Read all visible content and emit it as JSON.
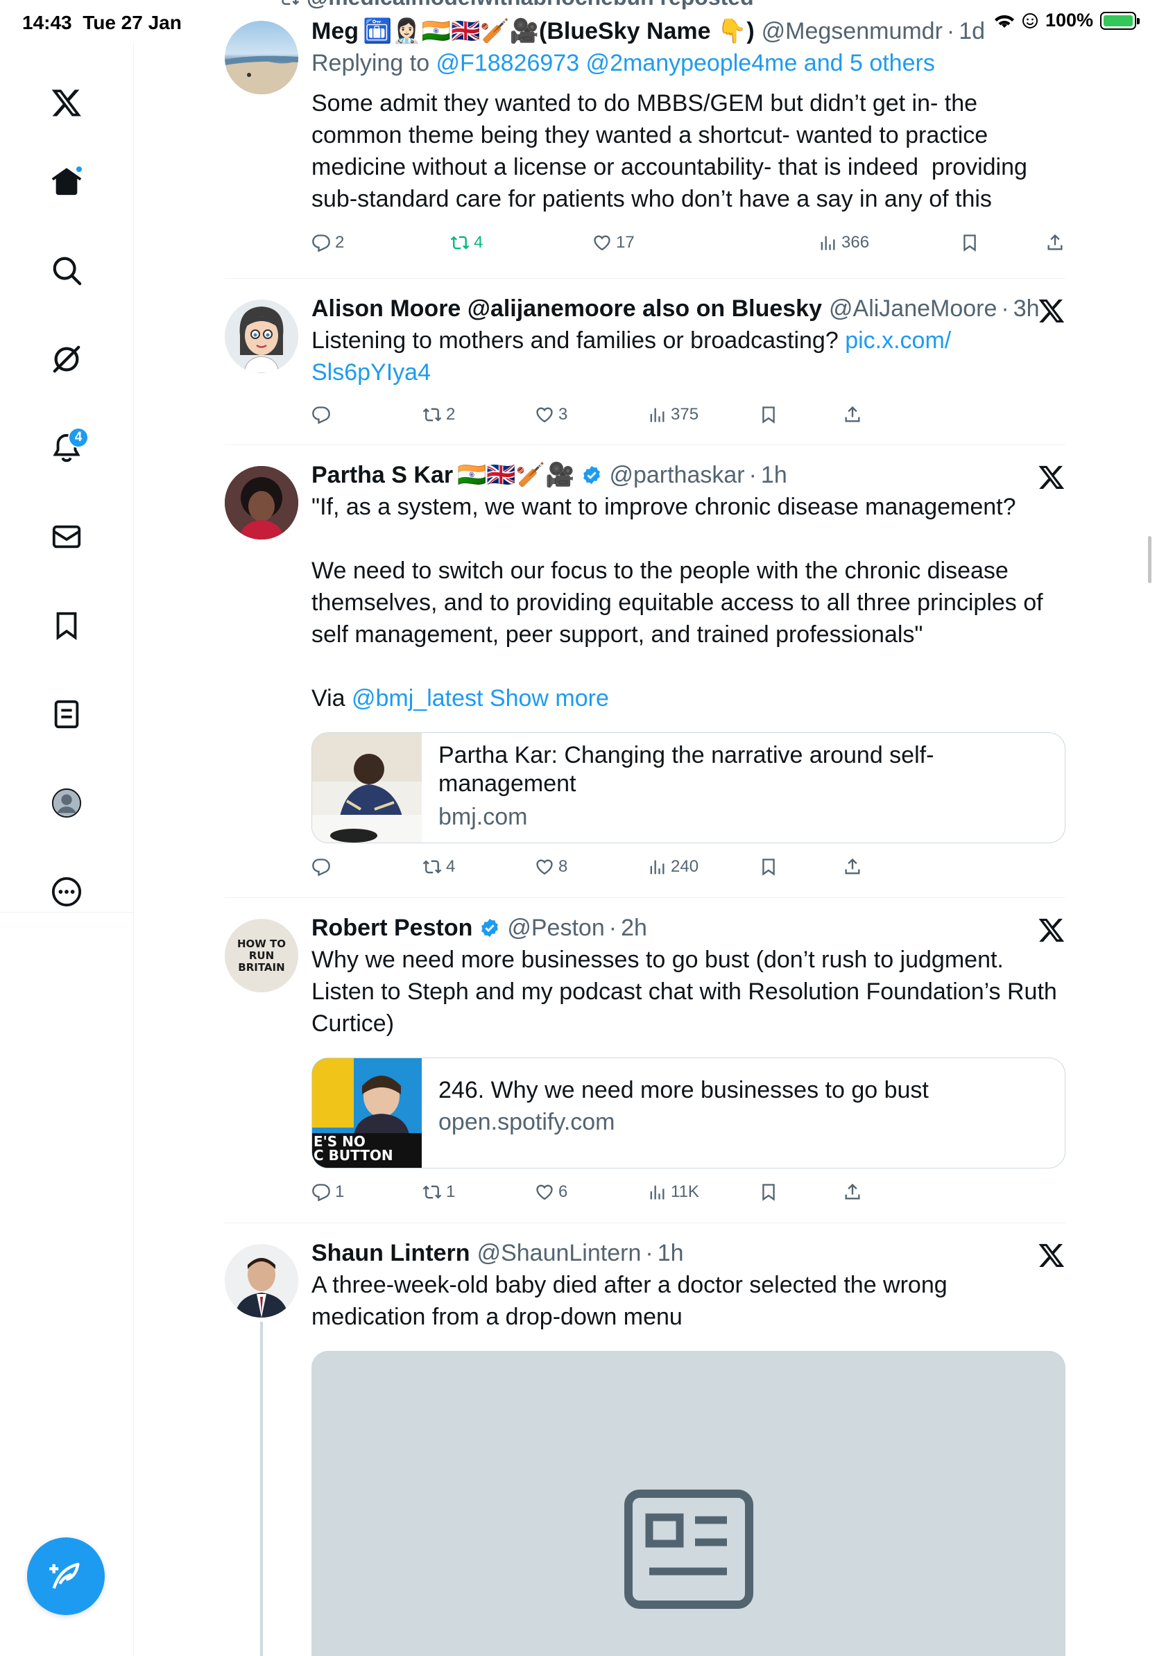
{
  "status_bar": {
    "time": "14:43",
    "date": "Tue 27 Jan",
    "battery": "100%"
  },
  "sidebar": {
    "notifications_badge": "4"
  },
  "feed": {
    "repost_banner": "@medicalmodelwithabriochebun reposted",
    "tweets": [
      {
        "name": "Meg",
        "name_suffix": "🛅👩🏻‍⚕️🇮🇳🇬🇧🏏🎥(BlueSky Name 👇)",
        "handle": "@Megsenmumdr",
        "time": "1d",
        "replying_prefix": "Replying to ",
        "replying_to": "@F18826973 @2manypeople4me and 5 others",
        "text": "Some admit they wanted to do MBBS/GEM but didn’t get in- the common theme being they wanted a shortcut- wanted to practice medicine without a license or accountability- that is indeed  providing sub-standard care for patients who don’t have a say in any of this",
        "replies": "2",
        "reposts": "4",
        "likes": "17",
        "views": "366"
      },
      {
        "name": "Alison Moore @alijanemoore also on Bluesky",
        "handle": "@AliJaneMoore",
        "time": "3h",
        "text": "Listening to mothers and families or broadcasting? ",
        "link": "pic.x.com/\nSls6pYIya4",
        "replies": "",
        "reposts": "2",
        "likes": "3",
        "views": "375"
      },
      {
        "name": "Partha S Kar",
        "name_suffix": "🇮🇳🇬🇧🏏🎥",
        "handle": "@parthaskar",
        "time": "1h",
        "text": "\"If, as a system, we want to improve chronic disease management?\n\nWe need to switch our focus to the people with the chronic disease themselves, and to providing equitable access to all three principles of self management, peer support, and trained professionals\"\n\nVia ",
        "via_link": "@bmj_latest",
        "show_more": "Show more",
        "card_title": "Partha Kar: Changing the narrative around self-management",
        "card_domain": "bmj.com",
        "replies": "",
        "reposts": "4",
        "likes": "8",
        "views": "240"
      },
      {
        "name": "Robert Peston",
        "handle": "@Peston",
        "time": "2h",
        "text": "Why we need more businesses to go bust (don’t rush to judgment. Listen to Steph and my podcast chat with Resolution Foundation’s Ruth Curtice)",
        "card_title": "246. Why we need more businesses to go bust",
        "card_domain": "open.spotify.com",
        "thumb_text": "E'S NO\nC BUTTON",
        "avatar_text": "HOW TO\nRUN\nBRITAIN",
        "replies": "1",
        "reposts": "1",
        "likes": "6",
        "views": "11K"
      },
      {
        "name": "Shaun Lintern",
        "handle": "@ShaunLintern",
        "time": "1h",
        "text": "A three-week-old baby died after a doctor selected the wrong medication from a drop-down menu"
      }
    ]
  },
  "colors": {
    "accent": "#1d9bf0",
    "repost_green": "#00ba7c",
    "muted": "#536471"
  }
}
